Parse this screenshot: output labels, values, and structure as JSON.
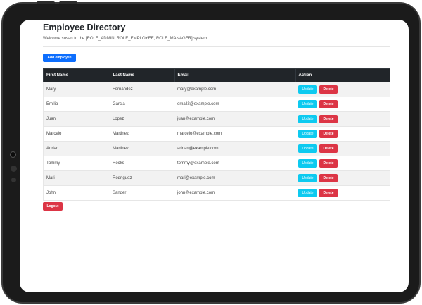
{
  "page": {
    "title": "Employee Directory",
    "welcome": "Welcome susan to the [ROLE_ADMIN, ROLE_EMPLOYEE, ROLE_MANAGER] system."
  },
  "toolbar": {
    "add_label": "Add employee",
    "logout_label": "Logout"
  },
  "table": {
    "headers": [
      "First Name",
      "Last Name",
      "Email",
      "Action"
    ],
    "rows": [
      {
        "first": "Mary",
        "last": "Fernandez",
        "email": "mary@example.com"
      },
      {
        "first": "Emilio",
        "last": "Garcia",
        "email": "email2@example.com"
      },
      {
        "first": "Juan",
        "last": "Lopez",
        "email": "juan@example.com"
      },
      {
        "first": "Marcelo",
        "last": "Martinez",
        "email": "marcelo@example.com"
      },
      {
        "first": "Adrian",
        "last": "Martinez",
        "email": "adrian@example.com"
      },
      {
        "first": "Tommy",
        "last": "Rocks",
        "email": "tommy@example.com"
      },
      {
        "first": "Mari",
        "last": "Rodriguez",
        "email": "mari@example.com"
      },
      {
        "first": "John",
        "last": "Sander",
        "email": "john@example.com"
      }
    ],
    "update_label": "Update",
    "delete_label": "Delete"
  },
  "colors": {
    "primary": "#0d6efd",
    "info": "#0dcaf0",
    "danger": "#dc3545",
    "header_dark": "#212529"
  }
}
